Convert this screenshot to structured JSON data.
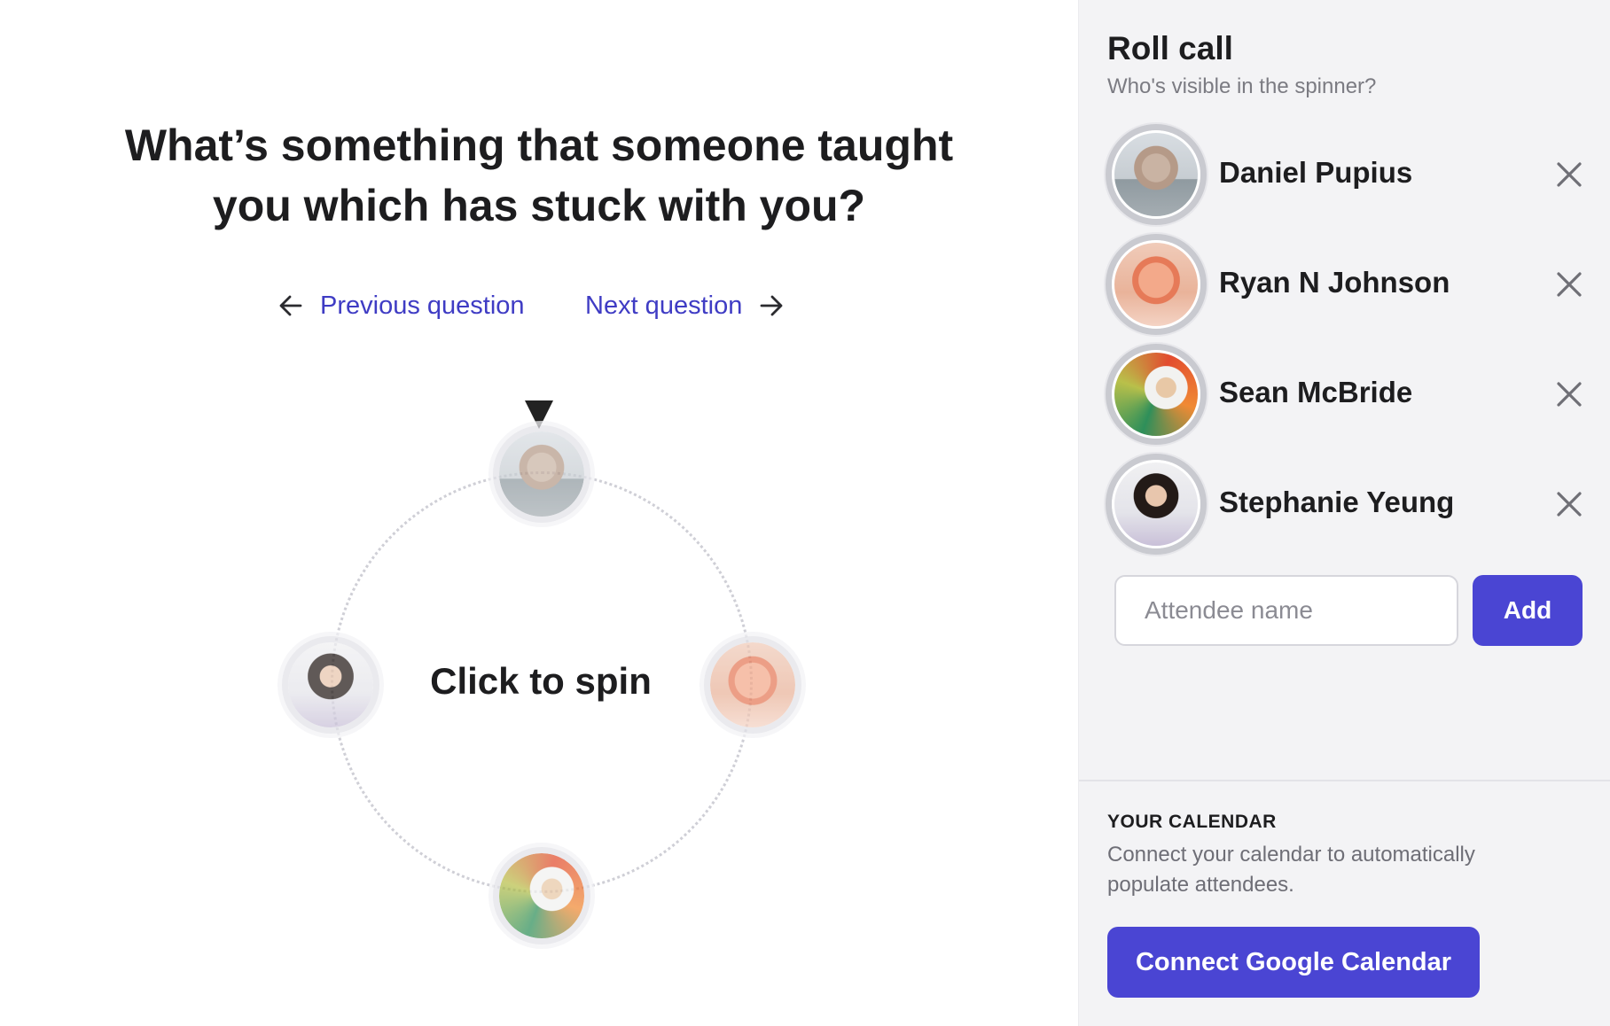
{
  "main": {
    "question_line1": "What’s something that someone taught",
    "question_line2": "you which has stuck with you?",
    "prev_label": "Previous question",
    "next_label": "Next question",
    "spin_label": "Click to spin"
  },
  "sidebar": {
    "title": "Roll call",
    "subtitle": "Who's visible in the spinner?",
    "attendees": [
      {
        "name": "Daniel Pupius"
      },
      {
        "name": "Ryan N Johnson"
      },
      {
        "name": "Sean McBride"
      },
      {
        "name": "Stephanie Yeung"
      }
    ],
    "add_placeholder": "Attendee name",
    "add_label": "Add",
    "calendar_heading": "YOUR CALENDAR",
    "calendar_text": "Connect your calendar to automatically populate attendees.",
    "calendar_button": "Connect Google Calendar"
  },
  "colors": {
    "accent": "#4a45d3",
    "link": "#3f3cc4",
    "sidebar_bg": "#f3f3f5"
  },
  "icons": {
    "prev": "arrow-left-icon",
    "next": "arrow-right-icon",
    "remove": "close-icon",
    "pointer": "triangle-down-icon"
  }
}
